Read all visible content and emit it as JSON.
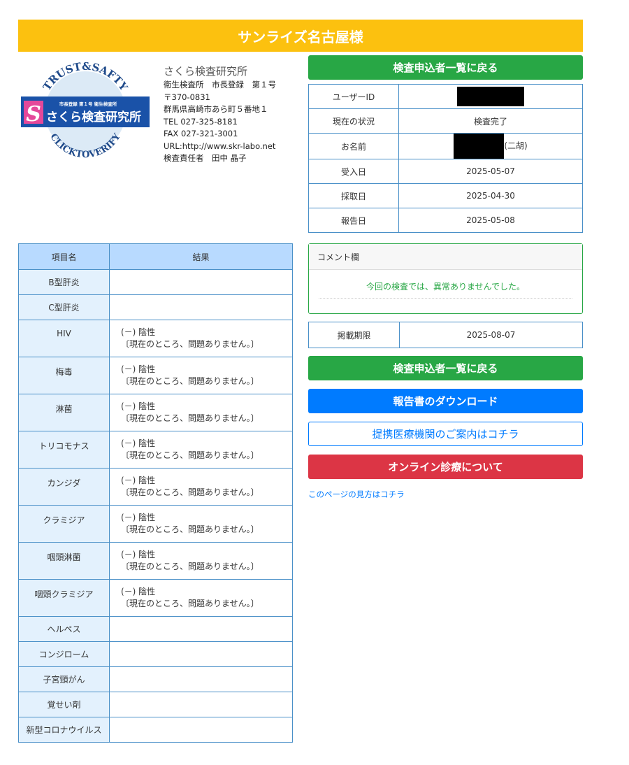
{
  "header": {
    "title": "サンライズ名古屋様"
  },
  "logo": {
    "text_top": "TRUST&SAFTY",
    "text_bottom": "CLICKTOVERIFY",
    "badge_small": "市長登録 第１号 衛生検査所",
    "badge_main": "さくら検査研究所",
    "badge_letter": "S"
  },
  "lab": {
    "name": "さくら検査研究所",
    "registration": "衛生検査所　市長登録　第１号",
    "postal": "〒370-0831",
    "address": "群馬県高崎市あら町５番地１",
    "tel": "TEL 027-325-8181",
    "fax": "FAX 027-321-3001",
    "url": "URL:http://www.skr-labo.net",
    "manager": "検査責任者　田中 晶子"
  },
  "buttons": {
    "back_top": "検査申込者一覧に戻る",
    "back_bottom": "検査申込者一覧に戻る",
    "download": "報告書のダウンロード",
    "partner": "提携医療機関のご案内はコチラ",
    "online": "オンライン診療について",
    "help_link": "このページの見方はコチラ"
  },
  "info": {
    "user_id_label": "ユーザーID",
    "status_label": "現在の状況",
    "status_value": "検査完了",
    "name_label": "お名前",
    "name_suffix": "(二胡)",
    "received_label": "受入日",
    "received_value": "2025-05-07",
    "collected_label": "採取日",
    "collected_value": "2025-04-30",
    "reported_label": "報告日",
    "reported_value": "2025-05-08"
  },
  "comment": {
    "label": "コメント欄",
    "text": "今回の検査では、異常ありませんでした。"
  },
  "deadline": {
    "label": "掲載期限",
    "value": "2025-08-07"
  },
  "results": {
    "col_name": "項目名",
    "col_result": "結果",
    "rows": [
      {
        "name": "B型肝炎",
        "line1": "",
        "line2": ""
      },
      {
        "name": "C型肝炎",
        "line1": "",
        "line2": ""
      },
      {
        "name": "HIV",
        "line1": "(－) 陰性",
        "line2": "〔現在のところ、問題ありません。〕"
      },
      {
        "name": "梅毒",
        "line1": "(－) 陰性",
        "line2": "〔現在のところ、問題ありません。〕"
      },
      {
        "name": "淋菌",
        "line1": "(－) 陰性",
        "line2": "〔現在のところ、問題ありません。〕"
      },
      {
        "name": "トリコモナス",
        "line1": "(－) 陰性",
        "line2": "〔現在のところ、問題ありません。〕"
      },
      {
        "name": "カンジダ",
        "line1": "(－) 陰性",
        "line2": "〔現在のところ、問題ありません。〕"
      },
      {
        "name": "クラミジア",
        "line1": "(－) 陰性",
        "line2": "〔現在のところ、問題ありません。〕"
      },
      {
        "name": "咽頭淋菌",
        "line1": "(－) 陰性",
        "line2": "〔現在のところ、問題ありません。〕"
      },
      {
        "name": "咽頭クラミジア",
        "line1": "(－) 陰性",
        "line2": "〔現在のところ、問題ありません。〕"
      },
      {
        "name": "ヘルペス",
        "line1": "",
        "line2": ""
      },
      {
        "name": "コンジローム",
        "line1": "",
        "line2": ""
      },
      {
        "name": "子宮頸がん",
        "line1": "",
        "line2": ""
      },
      {
        "name": "覚せい剤",
        "line1": "",
        "line2": ""
      },
      {
        "name": "新型コロナウイルス",
        "line1": "",
        "line2": ""
      }
    ]
  },
  "colors": {
    "banner": "#fcc10f",
    "green": "#28a745",
    "blue": "#007bff",
    "red": "#dc3545",
    "table_border": "#4a90c8",
    "header_cell": "#b8daff",
    "name_cell": "#e3f1fd"
  }
}
